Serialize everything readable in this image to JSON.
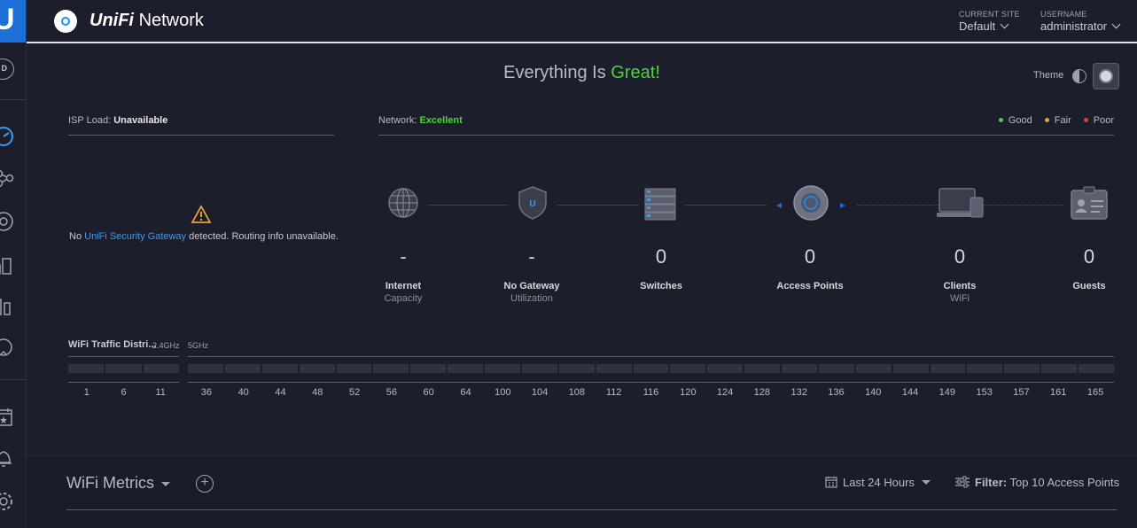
{
  "sidebar": {
    "logo": "U",
    "site_badge": "D"
  },
  "header": {
    "brand_prefix": "UniFi",
    "brand_suffix": "Network",
    "site_label": "CURRENT SITE",
    "site_value": "Default",
    "user_label": "USERNAME",
    "user_value": "administrator"
  },
  "status": {
    "prefix": "Everything Is",
    "highlight": "Great!",
    "theme_label": "Theme"
  },
  "isp": {
    "label": "ISP Load:",
    "value": "Unavailable",
    "warning_prefix": "No",
    "warning_link": "UniFi Security Gateway",
    "warning_suffix": "detected. Routing info unavailable."
  },
  "network": {
    "label": "Network:",
    "value": "Excellent",
    "legend": [
      {
        "label": "Good",
        "color": "#4ad43c"
      },
      {
        "label": "Fair",
        "color": "#e8a13a"
      },
      {
        "label": "Poor",
        "color": "#e83a3a"
      }
    ]
  },
  "topology": [
    {
      "value": "-",
      "label": "Internet",
      "sub": "Capacity",
      "icon": "globe-icon"
    },
    {
      "value": "-",
      "label": "No Gateway",
      "sub": "Utilization",
      "icon": "shield-icon"
    },
    {
      "value": "0",
      "label": "Switches",
      "sub": "",
      "icon": "switch-icon"
    },
    {
      "value": "0",
      "label": "Access Points",
      "sub": "",
      "icon": "access-point-icon"
    },
    {
      "value": "0",
      "label": "Clients",
      "sub": "WiFi",
      "icon": "laptop-icon"
    },
    {
      "value": "0",
      "label": "Guests",
      "sub": "",
      "icon": "guest-badge-icon"
    }
  ],
  "wifi_traffic": {
    "title": "WiFi Traffic Distri...",
    "band_24": "2.4GHz",
    "band_5": "5GHz",
    "channels_24": [
      "1",
      "6",
      "11"
    ],
    "channels_5": [
      "36",
      "40",
      "44",
      "48",
      "52",
      "56",
      "60",
      "64",
      "100",
      "104",
      "108",
      "112",
      "116",
      "120",
      "124",
      "128",
      "132",
      "136",
      "140",
      "144",
      "149",
      "153",
      "157",
      "161",
      "165"
    ]
  },
  "wifi_metrics": {
    "title": "WiFi Metrics",
    "add": "+",
    "range": "Last 24 Hours",
    "filter_label": "Filter:",
    "filter_value": "Top 10 Access Points"
  }
}
